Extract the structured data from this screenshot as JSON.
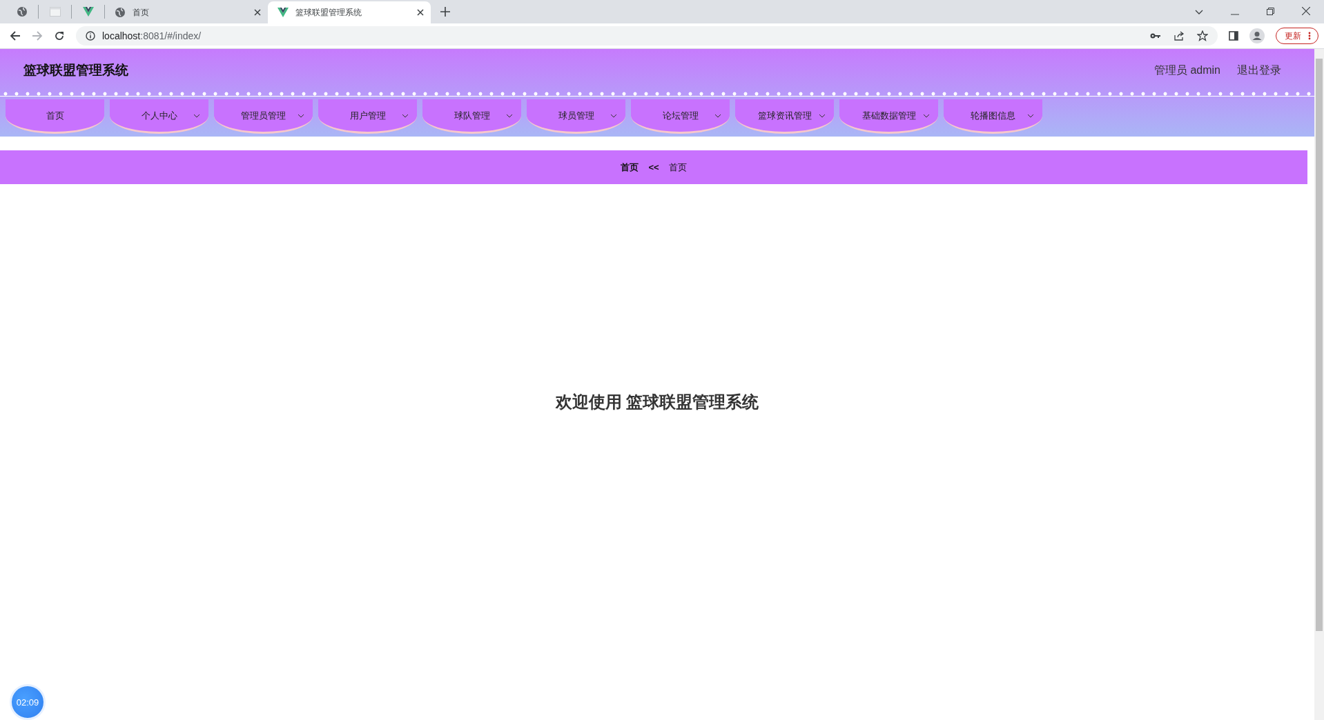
{
  "browser": {
    "tabs": [
      {
        "kind": "pinned",
        "selected": false
      },
      {
        "kind": "pinned-blank",
        "selected": false
      },
      {
        "kind": "pinned-vue",
        "selected": false
      },
      {
        "kind": "globe",
        "title": "首页",
        "selected": false
      },
      {
        "kind": "vue",
        "title": "篮球联盟管理系统",
        "selected": true
      }
    ],
    "url_host": "localhost",
    "url_rest": ":8081/#/index/",
    "update_button": "更新"
  },
  "header": {
    "title": "篮球联盟管理系统",
    "user": "管理员 admin",
    "logout": "退出登录"
  },
  "nav": [
    {
      "label": "首页",
      "has_dropdown": false
    },
    {
      "label": "个人中心",
      "has_dropdown": true
    },
    {
      "label": "管理员管理",
      "has_dropdown": true
    },
    {
      "label": "用户管理",
      "has_dropdown": true
    },
    {
      "label": "球队管理",
      "has_dropdown": true
    },
    {
      "label": "球员管理",
      "has_dropdown": true
    },
    {
      "label": "论坛管理",
      "has_dropdown": true
    },
    {
      "label": "篮球资讯管理",
      "has_dropdown": true
    },
    {
      "label": "基础数据管理",
      "has_dropdown": true
    },
    {
      "label": "轮播图信息",
      "has_dropdown": true
    }
  ],
  "breadcrumb": {
    "root": "首页",
    "separator": "<<",
    "current": "首页"
  },
  "welcome": "欢迎使用 篮球联盟管理系统",
  "timer": "02:09"
}
